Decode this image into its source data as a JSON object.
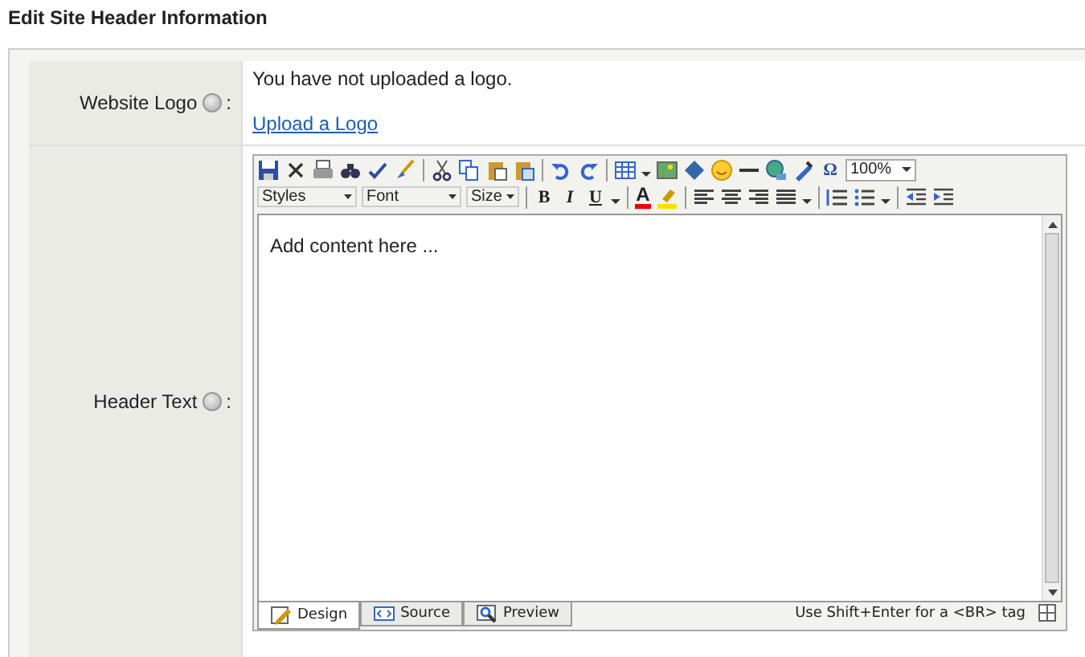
{
  "page": {
    "title": "Edit Site Header Information"
  },
  "rows": [
    {
      "kind": "logo",
      "label": "Website Logo",
      "colon": ":",
      "message": "You have not uploaded a logo.",
      "link": "Upload a Logo"
    },
    {
      "kind": "editor",
      "label": "Header Text",
      "colon": ":"
    }
  ],
  "editor": {
    "zoom": "100%",
    "styles": "Styles",
    "font": "Font",
    "size": "Size",
    "bold": "B",
    "italic": "I",
    "underline": "U",
    "font_color": "A",
    "special_char": "Ω",
    "placeholder": "Add content here ...",
    "tabs": [
      {
        "kind": "design",
        "label": "Design",
        "selected": true
      },
      {
        "kind": "source",
        "label": "Source",
        "selected": false
      },
      {
        "kind": "preview",
        "label": "Preview",
        "selected": false
      }
    ],
    "hint": "Use Shift+Enter for a <BR> tag"
  }
}
